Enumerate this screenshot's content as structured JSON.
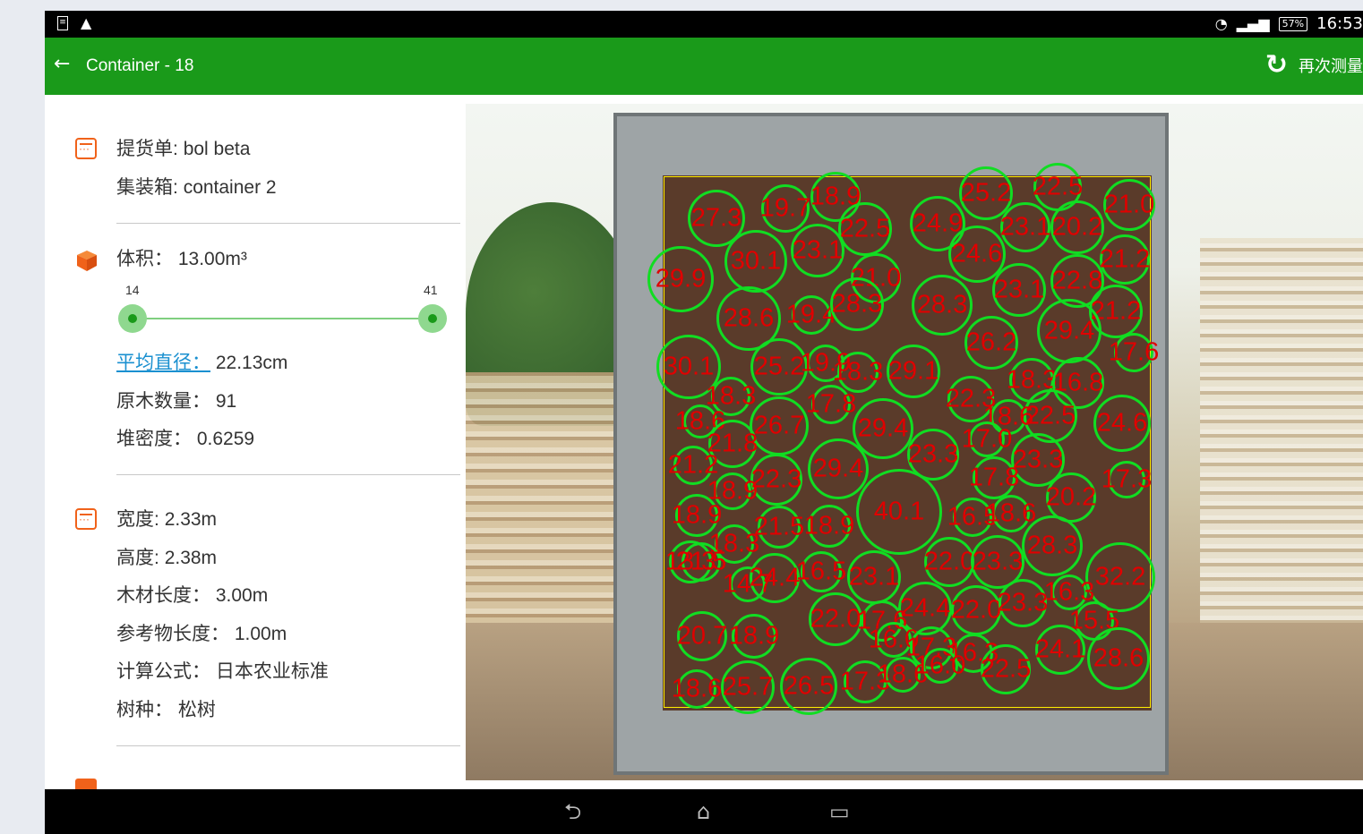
{
  "statusbar": {
    "left_icons": [
      "sim-card-icon",
      "warning-icon"
    ],
    "battery": "57%",
    "time": "16:53"
  },
  "appbar": {
    "back_icon": "arrow-left-icon",
    "title": "Container - 18",
    "remeasure_icon": "refresh-icon",
    "remeasure_label": "再次测量"
  },
  "info": {
    "bol_label": "提货单:",
    "bol_value": "bol beta",
    "container_label": "集装箱:",
    "container_value": "container 2",
    "volume_label": "体积：",
    "volume_value": "13.00m³",
    "slider_min_label": "14",
    "slider_max_label": "41",
    "slider_min": 14,
    "slider_max": 41,
    "avg_label": "平均直径：",
    "avg_value": "22.13cm",
    "count_label": "原木数量：",
    "count_value": "91",
    "density_label": "堆密度：",
    "density_value": "0.6259",
    "width_label": "宽度:",
    "width_value": "2.33m",
    "height_label": "高度:",
    "height_value": "2.38m",
    "wood_len_label": "木材长度：",
    "wood_len_value": "3.00m",
    "ref_len_label": "参考物长度：",
    "ref_len_value": "1.00m",
    "formula_label": "计算公式：",
    "formula_value": "日本农业标准",
    "species_label": "树种：",
    "species_value": "松树"
  },
  "colors": {
    "appbar": "#1a9a1a",
    "accent_icon": "#f0621a",
    "link": "#1a90d0",
    "circle": "#11dd22",
    "label": "#e00000"
  },
  "logs": [
    {
      "label": "27.3"
    },
    {
      "label": "19.7"
    },
    {
      "label": "18.9"
    },
    {
      "label": "22.5"
    },
    {
      "label": "24.9"
    },
    {
      "label": "25.2"
    },
    {
      "label": "22.5"
    },
    {
      "label": "23.1"
    },
    {
      "label": "20.2"
    },
    {
      "label": "21.0"
    },
    {
      "label": "30.1"
    },
    {
      "label": "23.1"
    },
    {
      "label": "24.6"
    },
    {
      "label": "21.2"
    },
    {
      "label": "29.9"
    },
    {
      "label": "21.0"
    },
    {
      "label": "28.3"
    },
    {
      "label": "23.1"
    },
    {
      "label": "22.8"
    },
    {
      "label": "28.6"
    },
    {
      "label": "19.4"
    },
    {
      "label": "28.3"
    },
    {
      "label": "21.2"
    },
    {
      "label": "26.2"
    },
    {
      "label": "29.4"
    },
    {
      "label": "17.6"
    },
    {
      "label": "30.1"
    },
    {
      "label": "25.2"
    },
    {
      "label": "19.9"
    },
    {
      "label": "18.3"
    },
    {
      "label": "29.1"
    },
    {
      "label": "18.3"
    },
    {
      "label": "16.8"
    },
    {
      "label": "18.3"
    },
    {
      "label": "22.3"
    },
    {
      "label": "17.8"
    },
    {
      "label": "18.6"
    },
    {
      "label": "22.5"
    },
    {
      "label": "24.6"
    },
    {
      "label": "18.6"
    },
    {
      "label": "26.7"
    },
    {
      "label": "29.4"
    },
    {
      "label": "17.0"
    },
    {
      "label": "21.8"
    },
    {
      "label": "23.3"
    },
    {
      "label": "23.3"
    },
    {
      "label": "21.2"
    },
    {
      "label": "22.3"
    },
    {
      "label": "29.4"
    },
    {
      "label": "17.8"
    },
    {
      "label": "17.3"
    },
    {
      "label": "18.9"
    },
    {
      "label": "20.2"
    },
    {
      "label": "40.1"
    },
    {
      "label": "16.5"
    },
    {
      "label": "18.6"
    },
    {
      "label": "18.9"
    },
    {
      "label": "21.5"
    },
    {
      "label": "18.9"
    },
    {
      "label": "18.3"
    },
    {
      "label": "28.3"
    },
    {
      "label": "18.3"
    },
    {
      "label": "21.5"
    },
    {
      "label": "22.0"
    },
    {
      "label": "23.3"
    },
    {
      "label": "32.2"
    },
    {
      "label": "14.7"
    },
    {
      "label": "24.4"
    },
    {
      "label": "16.5"
    },
    {
      "label": "23.1"
    },
    {
      "label": "16.3"
    },
    {
      "label": "24.4"
    },
    {
      "label": "22.0"
    },
    {
      "label": "23.3"
    },
    {
      "label": "22.0"
    },
    {
      "label": "17.6"
    },
    {
      "label": "15.5"
    },
    {
      "label": "20.7"
    },
    {
      "label": "18.9"
    },
    {
      "label": "16.0"
    },
    {
      "label": "17.3"
    },
    {
      "label": "16.3"
    },
    {
      "label": "24.1"
    },
    {
      "label": "28.6"
    },
    {
      "label": "18.6"
    },
    {
      "label": "25.7"
    },
    {
      "label": "26.5"
    },
    {
      "label": "17.3"
    },
    {
      "label": "18.6"
    },
    {
      "label": "16.0"
    },
    {
      "label": "22.5"
    }
  ],
  "navbar": {
    "back_icon": "back-icon",
    "home_icon": "home-icon",
    "recents_icon": "recents-icon"
  }
}
